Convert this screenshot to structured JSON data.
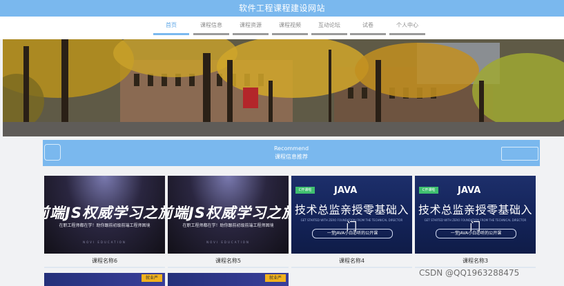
{
  "header": {
    "title": "软件工程课程建设网站"
  },
  "nav": {
    "items": [
      {
        "label": "首页",
        "active": true
      },
      {
        "label": "课程信息",
        "active": false
      },
      {
        "label": "课程资源",
        "active": false
      },
      {
        "label": "课程视频",
        "active": false
      },
      {
        "label": "互动论坛",
        "active": false
      },
      {
        "label": "试卷",
        "active": false
      },
      {
        "label": "个人中心",
        "active": false
      }
    ]
  },
  "banner": {
    "description_icon": "campus-photo-banner"
  },
  "recommend": {
    "title_en": "Recommend",
    "title_cn": "课程信息推荐"
  },
  "courses": [
    {
      "name": "课程名称6",
      "kind": "js",
      "headline": "前端JS权威学习之旅",
      "subline": "在职工程师都在学！助你跟前初级前端工程师困境",
      "footer": "NOVI EDUCATION"
    },
    {
      "name": "课程名称5",
      "kind": "js",
      "headline": "前端JS权威学习之旅",
      "subline": "在职工程师都在学！助你跟前初级前端工程师困境",
      "footer": "NOVI EDUCATION"
    },
    {
      "name": "课程名称4",
      "kind": "java",
      "tag": "C开课啦",
      "word": "JAVA",
      "headline": "技术总监亲授零基础入门",
      "subline": "GET STARTED WITH ZERO FOUNDATION FROM THE TECHNICAL DIRECTOR",
      "pill": "一堂JAVA小白必听的公开课"
    },
    {
      "name": "课程名称3",
      "kind": "java",
      "tag": "C开课啦",
      "word": "JAVA",
      "headline": "技术总监亲授零基础入门",
      "subline": "GET STARTED WITH ZERO FOUNDATION FROM THE TECHNICAL DIRECTOR",
      "pill": "一堂JAVA小白必听的公开课"
    }
  ],
  "row2": [
    {
      "tag": "就业严"
    },
    {
      "tag": "就业严"
    }
  ],
  "watermark": {
    "text": "CSDN @QQ1963288475"
  },
  "colors": {
    "accent": "#7ab8ee",
    "page_bg": "#f1f2f4"
  }
}
